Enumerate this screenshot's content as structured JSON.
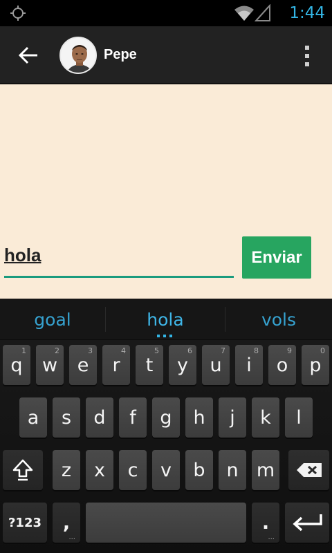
{
  "status_bar": {
    "time": "1:44",
    "icons": [
      "gps-icon",
      "wifi-icon",
      "signal-icon"
    ],
    "time_color": "#33b5e5"
  },
  "action_bar": {
    "back_icon": "arrow-left-icon",
    "contact_name": "Pepe",
    "overflow_icon": "more-vertical-icon",
    "background": "#222222"
  },
  "chat": {
    "background": "#faebd7",
    "input_value": "hola",
    "send_label": "Enviar",
    "send_color": "#27a560",
    "input_underline_color": "#1a9b7e"
  },
  "keyboard": {
    "suggestions": [
      "goal",
      "hola",
      "vols"
    ],
    "row1": [
      {
        "key": "q",
        "hint": "1"
      },
      {
        "key": "w",
        "hint": "2"
      },
      {
        "key": "e",
        "hint": "3"
      },
      {
        "key": "r",
        "hint": "4"
      },
      {
        "key": "t",
        "hint": "5"
      },
      {
        "key": "y",
        "hint": "6"
      },
      {
        "key": "u",
        "hint": "7"
      },
      {
        "key": "i",
        "hint": "8"
      },
      {
        "key": "o",
        "hint": "9"
      },
      {
        "key": "p",
        "hint": "0"
      }
    ],
    "row2": [
      "a",
      "s",
      "d",
      "f",
      "g",
      "h",
      "j",
      "k",
      "l"
    ],
    "row3": [
      "z",
      "x",
      "c",
      "v",
      "b",
      "n",
      "m"
    ],
    "symbols_label": "?123",
    "comma_label": ",",
    "period_label": ".",
    "dots_hint": "..."
  }
}
